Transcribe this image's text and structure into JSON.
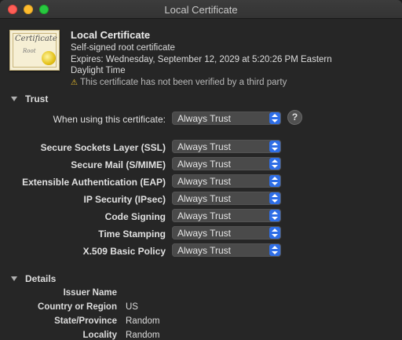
{
  "window": {
    "title": "Local Certificate"
  },
  "certificate": {
    "name": "Local Certificate",
    "type": "Self-signed root certificate",
    "expires_line1": "Expires: Wednesday, September 12, 2029 at 5:20:26 PM Eastern",
    "expires_line2": "Daylight Time",
    "warning_icon": "⚠",
    "warning": "This certificate has not been verified by a third party",
    "icon": {
      "script_top": "Certificate",
      "script_bottom": "Root"
    }
  },
  "trust": {
    "heading": "Trust",
    "when_using_label": "When using this certificate:",
    "when_using_value": "Always Trust",
    "help_label": "?",
    "rows": [
      {
        "label": "Secure Sockets Layer (SSL)",
        "value": "Always Trust"
      },
      {
        "label": "Secure Mail (S/MIME)",
        "value": "Always Trust"
      },
      {
        "label": "Extensible Authentication (EAP)",
        "value": "Always Trust"
      },
      {
        "label": "IP Security (IPsec)",
        "value": "Always Trust"
      },
      {
        "label": "Code Signing",
        "value": "Always Trust"
      },
      {
        "label": "Time Stamping",
        "value": "Always Trust"
      },
      {
        "label": "X.509 Basic Policy",
        "value": "Always Trust"
      }
    ]
  },
  "details": {
    "heading": "Details",
    "issuer_heading": "Issuer Name",
    "fields": [
      {
        "label": "Country or Region",
        "value": "US"
      },
      {
        "label": "State/Province",
        "value": "Random"
      },
      {
        "label": "Locality",
        "value": "Random"
      }
    ]
  }
}
